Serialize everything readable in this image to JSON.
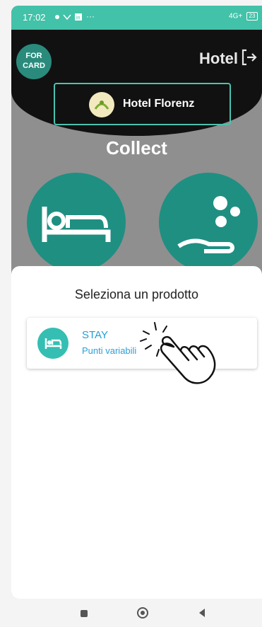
{
  "status_bar": {
    "time": "17:02",
    "icons": [
      "chat-icon",
      "cloud-icon",
      "linkedin-icon",
      "more-icon",
      "network-icon",
      "battery-icon"
    ],
    "network": "4G+",
    "battery": "23"
  },
  "header": {
    "title": "Hotel",
    "logo_text": "FOR CARD",
    "hotel_name": "Hotel Florenz",
    "subtitle": "Collect"
  },
  "sheet": {
    "title": "Seleziona un prodotto",
    "products": [
      {
        "title": "STAY",
        "subtitle": "Punti variabili",
        "icon": "bed-icon"
      }
    ]
  },
  "colors": {
    "accent": "#42c2a8",
    "teal_dark": "#1f8f82",
    "product_blue": "#239ed8"
  }
}
